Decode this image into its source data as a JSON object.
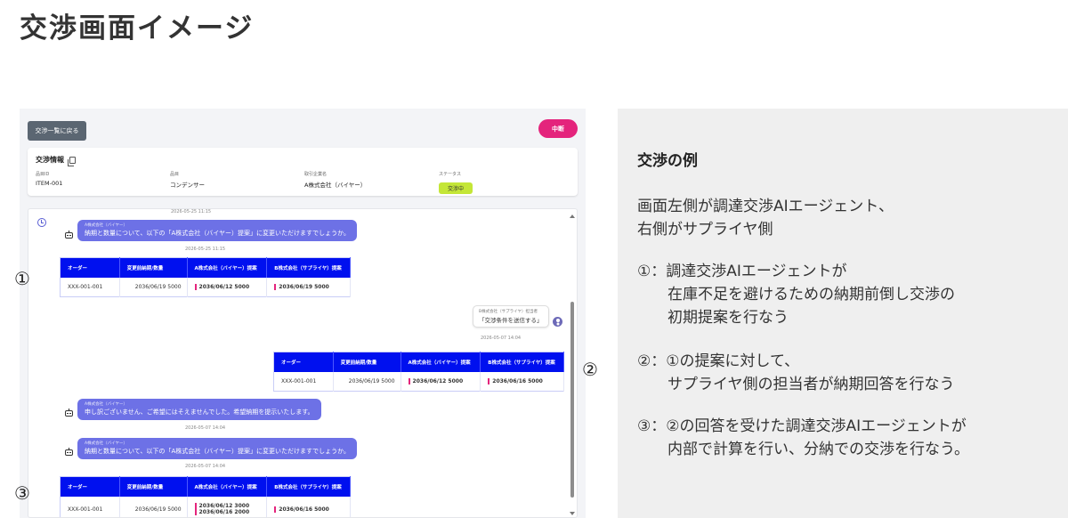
{
  "slide": {
    "title": "交渉画面イメージ"
  },
  "app": {
    "back_button": "交渉一覧に戻る",
    "stop_button": "中断",
    "info": {
      "title": "交渉情報",
      "fields": [
        {
          "label": "品目ID",
          "value": "ITEM-001"
        },
        {
          "label": "品目",
          "value": "コンデンサー"
        },
        {
          "label": "取引企業名",
          "value": "A株式会社（バイヤー）"
        },
        {
          "label": "ステータス",
          "value": "交渉中"
        }
      ]
    },
    "chat": {
      "top_timestamp": "2026-05-25 11:15",
      "messages": [
        {
          "sender": "A株式会社（バイヤー）",
          "text": "納期と数量について、以下の「A株式会社（バイヤー）提案」に変更いただけますでしょうか。",
          "timestamp": "2026-05-25 11:15"
        },
        {
          "sender": "B株式会社（サプライヤ）",
          "role": "B株式会社（サプライヤ）担当者",
          "text": "「交渉条件を送信する」",
          "timestamp": "2026-05-07 14:04"
        },
        {
          "sender": "A株式会社（バイヤー）",
          "text": "申し訳ございません、ご希望にはそえませんでした。希望納期を提示いたします。",
          "timestamp": "2026-05-07 14:04"
        },
        {
          "sender": "A株式会社（バイヤー）",
          "text": "納期と数量について、以下の「A株式会社（バイヤー）提案」に変更いただけますでしょうか。",
          "timestamp": "2026-05-07 14:04"
        }
      ],
      "table_headers": [
        "オーダー",
        "変更前納期/数量",
        "A株式会社（バイヤー）提案",
        "B株式会社（サプライヤ）提案"
      ],
      "tables": [
        {
          "order": "XXX-001-001",
          "before": "2036/06/19 5000",
          "a_proposal": [
            "2036/06/12 5000"
          ],
          "b_proposal": [
            "2036/06/19 5000"
          ]
        },
        {
          "order": "XXX-001-001",
          "before": "2036/06/19 5000",
          "a_proposal": [
            "2036/06/12 5000"
          ],
          "b_proposal": [
            "2036/06/16 5000"
          ]
        },
        {
          "order": "XXX-001-001",
          "before": "2036/06/19 5000",
          "a_proposal": [
            "2036/06/12 3000",
            "2036/06/16 2000"
          ],
          "b_proposal": [
            "2036/06/16 5000"
          ]
        }
      ]
    },
    "markers": [
      "①",
      "②",
      "③"
    ]
  },
  "panel": {
    "title": "交渉の例",
    "lines": [
      "画面左側が調達交渉AIエージェント、",
      "右側がサプライヤ側",
      "①：調達交渉AIエージェントが",
      "　　在庫不足を避けるための納期前倒し交渉の",
      "　　初期提案を行なう",
      "②：①の提案に対して、",
      "　　サプライヤ側の担当者が納期回答を行なう",
      "③：②の回答を受けた調達交渉AIエージェントが",
      "　　内部で計算を行い、分納での交渉を行なう。"
    ]
  }
}
